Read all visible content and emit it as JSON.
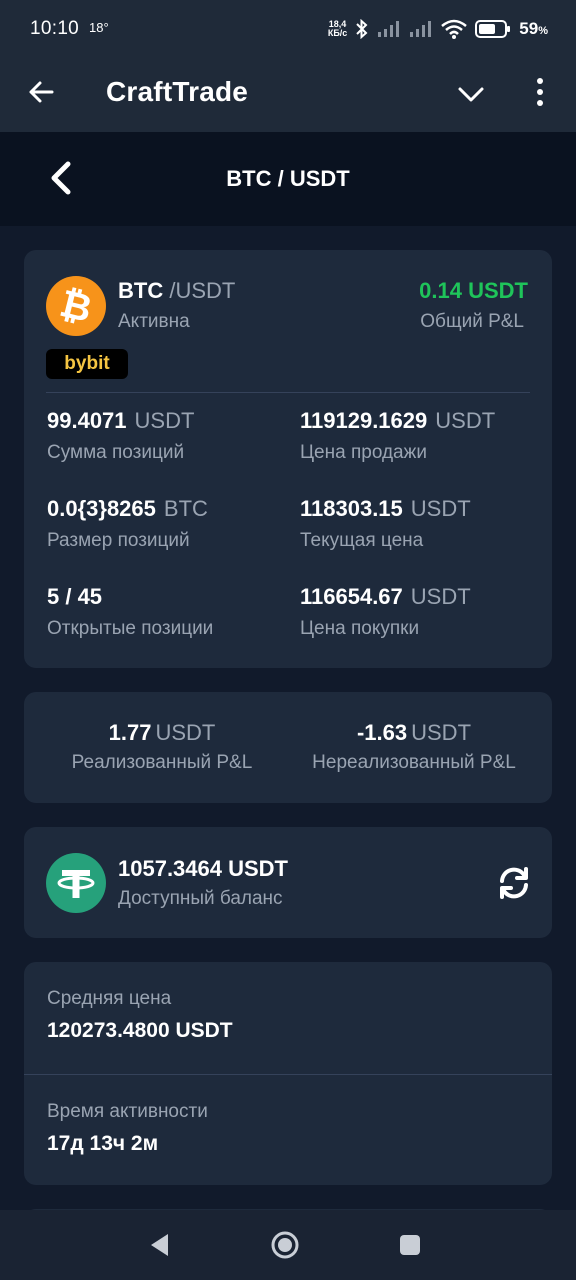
{
  "status_bar": {
    "time": "10:10",
    "temperature": "18°",
    "net_speed_value": "18,4",
    "net_speed_unit": "КБ/с",
    "battery": "59",
    "battery_unit": "%"
  },
  "app_bar": {
    "title": "CraftTrade"
  },
  "pair_header": {
    "title": "BTC / USDT"
  },
  "position_card": {
    "base": "BTC",
    "quote": "/USDT",
    "status": "Активна",
    "total_pnl": "0.14 USDT",
    "total_pnl_label": "Общий P&L",
    "exchange_badge": "bybit",
    "stats": [
      {
        "value": "99.4071",
        "unit": "USDT",
        "label": "Сумма позиций"
      },
      {
        "value": "119129.1629",
        "unit": "USDT",
        "label": "Цена продажи"
      },
      {
        "value": "0.0{3}8265",
        "unit": "BTC",
        "label": "Размер позиций"
      },
      {
        "value": "118303.15",
        "unit": "USDT",
        "label": "Текущая цена"
      },
      {
        "value": "5 / 45",
        "unit": "",
        "label": "Открытые позиции"
      },
      {
        "value": "116654.67",
        "unit": "USDT",
        "label": "Цена покупки"
      }
    ]
  },
  "pnl_card": {
    "realized_value": "1.77",
    "realized_unit": "USDT",
    "realized_label": "Реализованный P&L",
    "unrealized_value": "-1.63",
    "unrealized_unit": "USDT",
    "unrealized_label": "Нереализованный P&L"
  },
  "balance_card": {
    "value": "1057.3464 USDT",
    "label": "Доступный баланс"
  },
  "info_card": {
    "avg_price_label": "Средняя цена",
    "avg_price_value": "120273.4800 USDT",
    "active_time_label": "Время активности",
    "active_time_value": "17д 13ч 2м"
  },
  "colors": {
    "background": "#111a2b",
    "card": "#1e2a3c",
    "positive": "#1fc45a",
    "muted_text": "#9aa4b2",
    "badge_text": "#f5c542"
  },
  "icons": [
    "back-arrow-icon",
    "chevron-down-icon",
    "more-vert-icon",
    "chevron-left-icon",
    "bitcoin-icon",
    "tether-icon",
    "refresh-icon",
    "nav-back-icon",
    "nav-home-icon",
    "nav-recents-icon"
  ]
}
